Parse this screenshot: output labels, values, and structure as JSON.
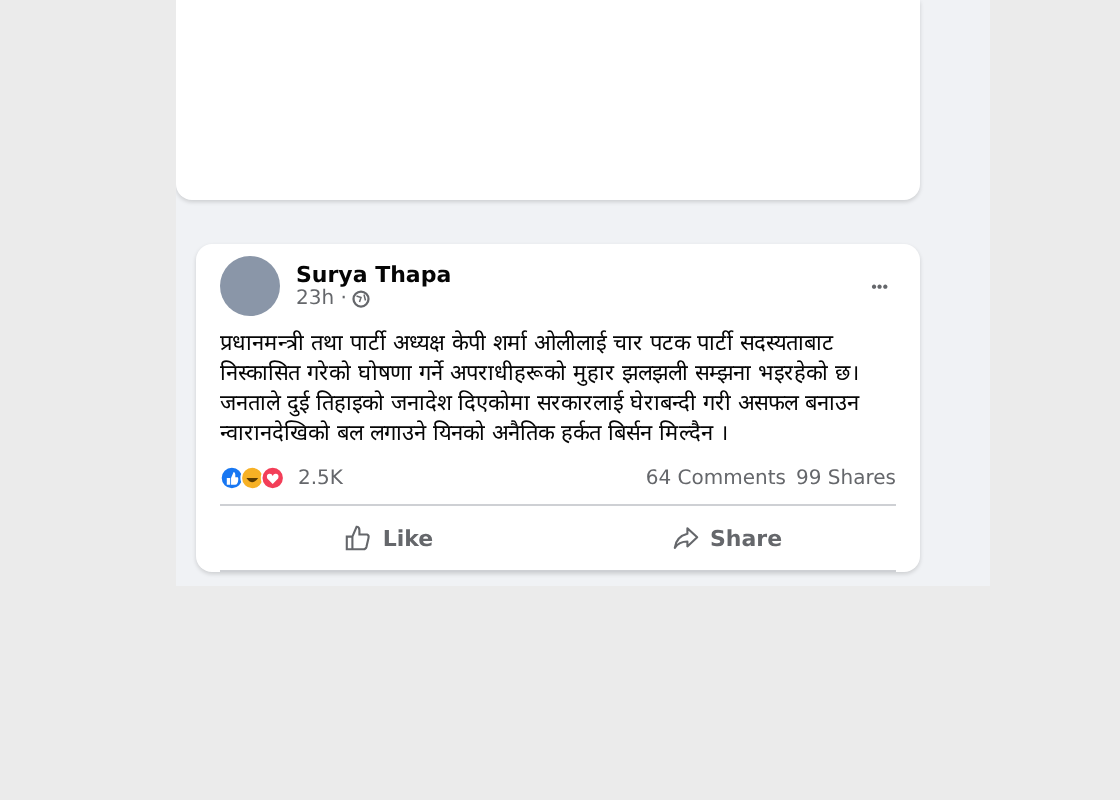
{
  "post": {
    "author": "Surya Thapa",
    "time": "23h ·",
    "more": "•••",
    "text": "प्रधानमन्त्री तथा पार्टी अध्यक्ष केपी शर्मा ओलीलाई चार पटक पार्टी सदस्यताबाट निस्कासित गरेको घोषणा गर्ने अपराधीहरूको मुहार झलझली सम्झना भइरहेको छ। जनताले दुई तिहाइको जनादेश दिएकोमा सरकारलाई घेराबन्दी गरी असफल बनाउन न्वारानदेखिको बल लगाउने यिनको अनैतिक हर्कत बिर्सन मिल्दैन ।",
    "reaction_count": "2.5K",
    "comments": "64 Comments",
    "shares": "99 Shares",
    "actions": [
      {
        "kind": "like",
        "label": "Like"
      },
      {
        "kind": "share",
        "label": "Share"
      }
    ]
  }
}
